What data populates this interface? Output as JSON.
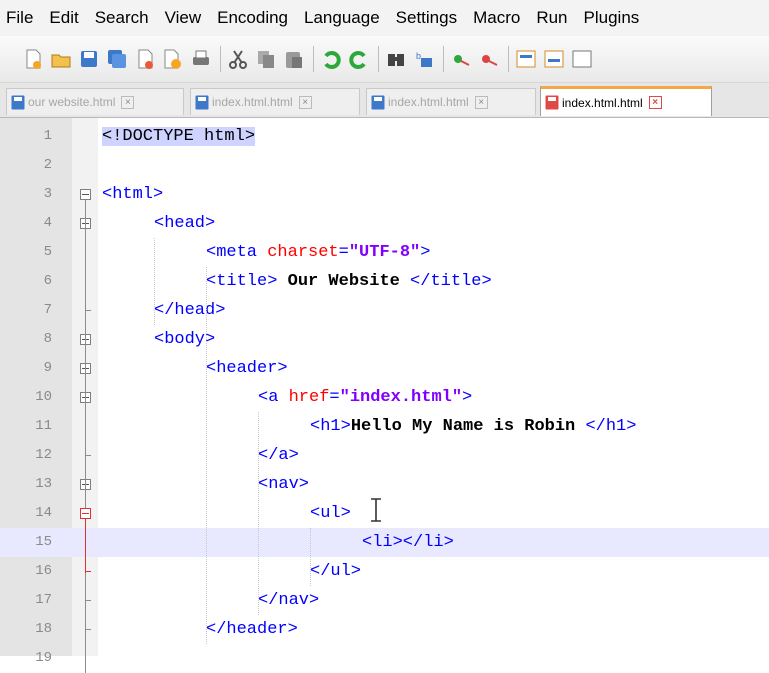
{
  "menu": [
    "File",
    "Edit",
    "Search",
    "View",
    "Encoding",
    "Language",
    "Settings",
    "Macro",
    "Run",
    "Plugins"
  ],
  "toolbar": {
    "groups": [
      [
        "new-file-icon",
        "open-file-icon",
        "save-icon",
        "save-all-icon",
        "close-icon",
        "close-all-icon",
        "print-icon"
      ],
      [
        "cut-icon",
        "copy-icon",
        "paste-icon"
      ],
      [
        "undo-icon",
        "redo-icon"
      ],
      [
        "find-icon",
        "replace-icon"
      ],
      [
        "zoom-in-icon",
        "zoom-out-icon"
      ],
      [
        "sync-vertical-icon",
        "sync-horizontal-icon",
        "word-wrap-icon"
      ]
    ]
  },
  "tabs": [
    {
      "label": "our website.html",
      "active": false
    },
    {
      "label": "index.html.html",
      "active": false
    },
    {
      "label": "index.html.html",
      "active": false
    },
    {
      "label": "index.html.html",
      "active": true
    }
  ],
  "editor": {
    "current_line": 15,
    "lines": [
      {
        "n": "1",
        "segs": [
          [
            "doct",
            "<!DOCTYPE html>"
          ]
        ]
      },
      {
        "n": "2",
        "segs": []
      },
      {
        "n": "3",
        "segs": [
          [
            "tag",
            "<html>"
          ]
        ]
      },
      {
        "n": "4",
        "segs": [
          [
            "tag",
            "<head>"
          ]
        ]
      },
      {
        "n": "5",
        "segs": [
          [
            "tag",
            "<meta "
          ],
          [
            "attr",
            "charset"
          ],
          [
            "tag",
            "="
          ],
          [
            "str",
            "\"UTF-8\""
          ],
          [
            "tag",
            ">"
          ]
        ]
      },
      {
        "n": "6",
        "segs": [
          [
            "tag",
            "<title>"
          ],
          [
            "txt",
            " Our Website "
          ],
          [
            "tag",
            "</title>"
          ]
        ]
      },
      {
        "n": "7",
        "segs": [
          [
            "tag",
            "</head>"
          ]
        ]
      },
      {
        "n": "8",
        "segs": [
          [
            "tag",
            "<body>"
          ]
        ]
      },
      {
        "n": "9",
        "segs": [
          [
            "tag",
            "<header>"
          ]
        ]
      },
      {
        "n": "10",
        "segs": [
          [
            "tag",
            "<a "
          ],
          [
            "attr",
            "href"
          ],
          [
            "tag",
            "="
          ],
          [
            "str",
            "\"index.html\""
          ],
          [
            "tag",
            ">"
          ]
        ]
      },
      {
        "n": "11",
        "segs": [
          [
            "tag",
            "<h1>"
          ],
          [
            "txt",
            "Hello My Name is Robin "
          ],
          [
            "tag",
            "</h1>"
          ]
        ]
      },
      {
        "n": "12",
        "segs": [
          [
            "tag",
            "</a>"
          ]
        ]
      },
      {
        "n": "13",
        "segs": [
          [
            "tag",
            "<nav>"
          ]
        ]
      },
      {
        "n": "14",
        "segs": [
          [
            "tag",
            "<ul>"
          ]
        ]
      },
      {
        "n": "15",
        "segs": [
          [
            "tag",
            "<li></li>"
          ]
        ]
      },
      {
        "n": "16",
        "segs": [
          [
            "tag",
            "</ul>"
          ]
        ]
      },
      {
        "n": "17",
        "segs": [
          [
            "tag",
            "</nav>"
          ]
        ]
      },
      {
        "n": "18",
        "segs": [
          [
            "tag",
            "</header>"
          ]
        ]
      },
      {
        "n": "19",
        "segs": []
      }
    ]
  }
}
